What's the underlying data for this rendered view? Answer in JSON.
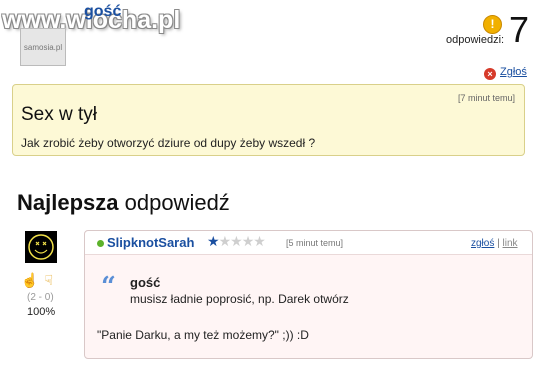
{
  "watermark": "www.wiocha.pl",
  "asker": {
    "name": "gość",
    "avatar_text": "samosia.pl"
  },
  "answers": {
    "icon": "question-icon",
    "label": "odpowiedzi:",
    "count": "7"
  },
  "report_link": "Zgłoś",
  "question": {
    "time": "[7 minut temu]",
    "title": "Sex w tył",
    "body": "Jak zrobić żeby otworzyć dziure od dupy żeby wszedł ?"
  },
  "best": {
    "bold": "Najlepsza",
    "rest": " odpowiedź"
  },
  "answer": {
    "author": "SlipknotSarah",
    "rating": {
      "value": 1,
      "max": 5
    },
    "time": "[5 minut temu]",
    "report": "zgłoś",
    "separator": "|",
    "link": "link",
    "votes": "(2 - 0)",
    "percent": "100%",
    "quoted_author": "gość",
    "quoted_text": "musisz ładnie poprosić, np. Darek otwórz",
    "reply": "\"Panie Darku, a my też możemy?\" ;)) :D"
  },
  "colors": {
    "name_blue": "#1a4fa0",
    "question_bg": "#fdf9d6",
    "answer_bg": "#fff5f5",
    "status_green": "#5cb22a"
  }
}
